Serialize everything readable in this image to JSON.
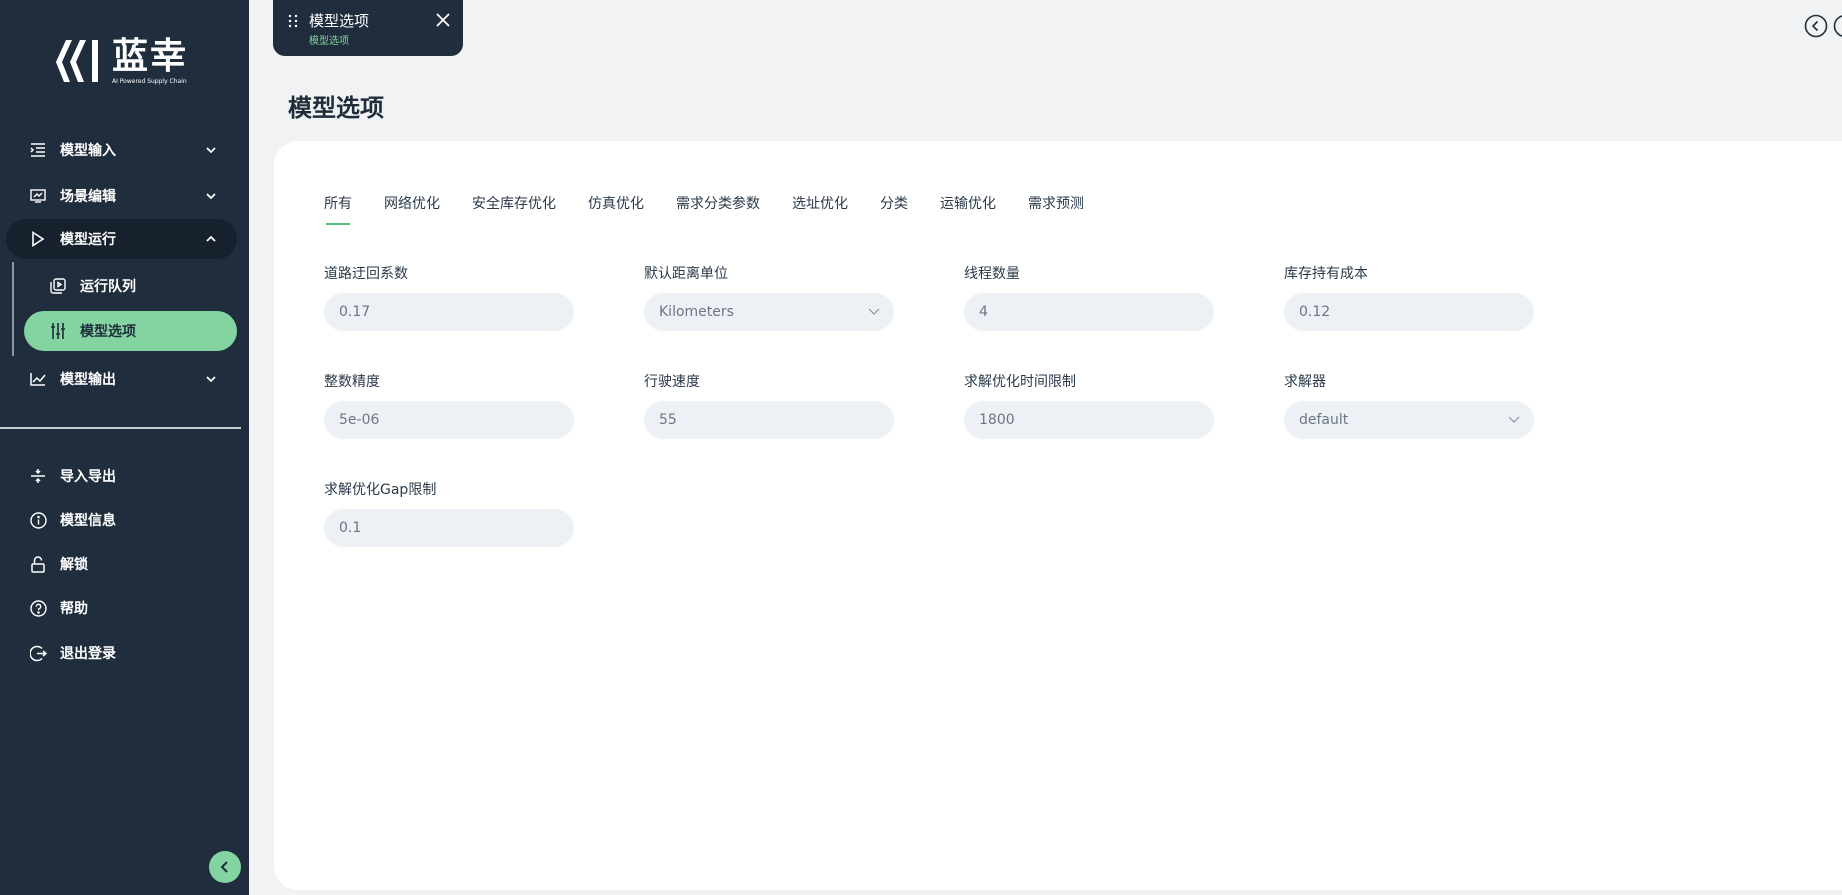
{
  "app": {
    "logo_cn": "蓝幸",
    "logo_en": "AI Powered Supply Chain"
  },
  "sidebar": {
    "items": [
      {
        "label": "模型输入",
        "icon": "list-indent-icon"
      },
      {
        "label": "场景编辑",
        "icon": "chart-edit-icon"
      },
      {
        "label": "模型运行",
        "icon": "play-icon"
      },
      {
        "label": "模型输出",
        "icon": "line-chart-icon"
      }
    ],
    "sub_items": [
      {
        "label": "运行队列",
        "icon": "queue-icon"
      },
      {
        "label": "模型选项",
        "icon": "sliders-icon"
      }
    ],
    "bottom_items": [
      {
        "label": "导入导出",
        "icon": "import-export-icon"
      },
      {
        "label": "模型信息",
        "icon": "info-icon"
      },
      {
        "label": "解锁",
        "icon": "unlock-icon"
      },
      {
        "label": "帮助",
        "icon": "help-icon"
      },
      {
        "label": "退出登录",
        "icon": "logout-icon"
      }
    ]
  },
  "tab_chip": {
    "title": "模型选项",
    "subtitle": "模型选项"
  },
  "page": {
    "title": "模型选项"
  },
  "tabs": [
    "所有",
    "网络优化",
    "安全库存优化",
    "仿真优化",
    "需求分类参数",
    "选址优化",
    "分类",
    "运输优化",
    "需求预测"
  ],
  "fields": [
    {
      "label": "道路迂回系数",
      "value": "0.17",
      "type": "input"
    },
    {
      "label": "默认距离单位",
      "value": "Kilometers",
      "type": "select"
    },
    {
      "label": "线程数量",
      "value": "4",
      "type": "input"
    },
    {
      "label": "库存持有成本",
      "value": "0.12",
      "type": "input"
    },
    {
      "label": "整数精度",
      "value": "5e-06",
      "type": "input"
    },
    {
      "label": "行驶速度",
      "value": "55",
      "type": "input"
    },
    {
      "label": "求解优化时间限制",
      "value": "1800",
      "type": "input"
    },
    {
      "label": "求解器",
      "value": "default",
      "type": "select"
    },
    {
      "label": "求解优化Gap限制",
      "value": "0.1",
      "type": "input"
    }
  ],
  "colors": {
    "sidebar_bg": "#1f2d3d",
    "accent": "#83d4a1",
    "tab_underline": "#4cc27a"
  }
}
